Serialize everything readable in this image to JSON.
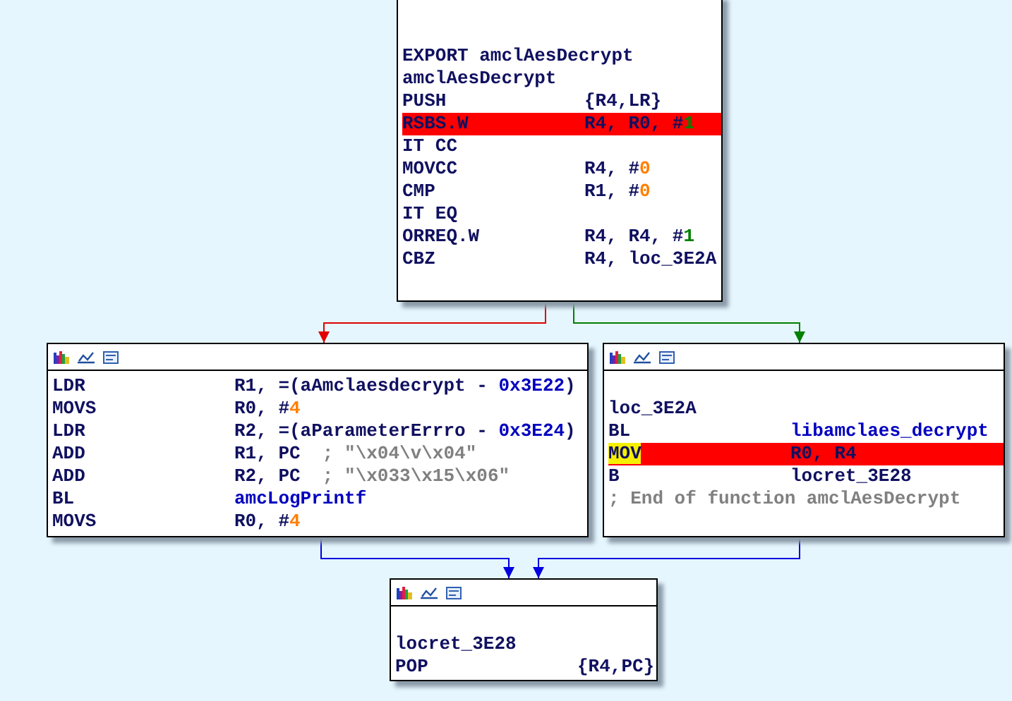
{
  "nodes": [
    {
      "header": false,
      "lines": [
        {
          "kind": "blank"
        },
        {
          "kind": "blank"
        },
        {
          "kind": "label",
          "text": "EXPORT amclAesDecrypt"
        },
        {
          "kind": "label",
          "text": "amclAesDecrypt"
        },
        {
          "kind": "insn",
          "mnemonic": "PUSH",
          "highlighted": false,
          "marked": false,
          "operands": [
            {
              "text": "{R4,LR}",
              "kind": "plain"
            }
          ]
        },
        {
          "kind": "insn",
          "mnemonic": "RSBS.W",
          "highlighted": true,
          "marked": false,
          "operands": [
            {
              "text": "R4, R0, #",
              "kind": "plain"
            },
            {
              "text": "1",
              "kind": "bitmask"
            }
          ]
        },
        {
          "kind": "insn",
          "mnemonic": "IT CC",
          "highlighted": false,
          "marked": false
        },
        {
          "kind": "insn",
          "mnemonic": "MOVCC",
          "highlighted": false,
          "marked": false,
          "operands": [
            {
              "text": "R4, #",
              "kind": "plain"
            },
            {
              "text": "0",
              "kind": "number"
            }
          ]
        },
        {
          "kind": "insn",
          "mnemonic": "CMP",
          "highlighted": false,
          "marked": false,
          "operands": [
            {
              "text": "R1, #",
              "kind": "plain"
            },
            {
              "text": "0",
              "kind": "number"
            }
          ]
        },
        {
          "kind": "insn",
          "mnemonic": "IT EQ",
          "highlighted": false,
          "marked": false
        },
        {
          "kind": "insn",
          "mnemonic": "ORREQ.W",
          "highlighted": false,
          "marked": false,
          "operands": [
            {
              "text": "R4, R4, #",
              "kind": "plain"
            },
            {
              "text": "1",
              "kind": "bitmask"
            }
          ]
        },
        {
          "kind": "insn",
          "mnemonic": "CBZ",
          "highlighted": false,
          "marked": false,
          "operands": [
            {
              "text": "R4, loc_3E2A",
              "kind": "plain"
            }
          ]
        }
      ]
    },
    {
      "header": true,
      "lines": [
        {
          "kind": "insn",
          "mnemonic": "LDR",
          "highlighted": false,
          "marked": false,
          "operands": [
            {
              "text": "R1, =(aAmclaesdecrypt - ",
              "kind": "plain"
            },
            {
              "text": "0x3E22",
              "kind": "name"
            },
            {
              "text": ")",
              "kind": "plain"
            }
          ]
        },
        {
          "kind": "insn",
          "mnemonic": "MOVS",
          "highlighted": false,
          "marked": false,
          "operands": [
            {
              "text": "R0, #",
              "kind": "plain"
            },
            {
              "text": "4",
              "kind": "number"
            }
          ]
        },
        {
          "kind": "insn",
          "mnemonic": "LDR",
          "highlighted": false,
          "marked": false,
          "operands": [
            {
              "text": "R2, =(aParameterErrro - ",
              "kind": "plain"
            },
            {
              "text": "0x3E24",
              "kind": "name"
            },
            {
              "text": ")",
              "kind": "plain"
            }
          ]
        },
        {
          "kind": "insn",
          "mnemonic": "ADD",
          "highlighted": false,
          "marked": false,
          "operands": [
            {
              "text": "R1, PC  ",
              "kind": "plain"
            },
            {
              "text": "; \"\\x04\\v\\x04\"",
              "kind": "comment"
            }
          ]
        },
        {
          "kind": "insn",
          "mnemonic": "ADD",
          "highlighted": false,
          "marked": false,
          "operands": [
            {
              "text": "R2, PC  ",
              "kind": "plain"
            },
            {
              "text": "; \"\\x033\\x15\\x06\"",
              "kind": "comment"
            }
          ]
        },
        {
          "kind": "insn",
          "mnemonic": "BL",
          "highlighted": false,
          "marked": false,
          "operands": [
            {
              "text": "amcLogPrintf",
              "kind": "name"
            }
          ]
        },
        {
          "kind": "insn",
          "mnemonic": "MOVS",
          "highlighted": false,
          "marked": false,
          "operands": [
            {
              "text": "R0, #",
              "kind": "plain"
            },
            {
              "text": "4",
              "kind": "number"
            }
          ]
        }
      ]
    },
    {
      "header": true,
      "lines": [
        {
          "kind": "blank"
        },
        {
          "kind": "label",
          "text": "loc_3E2A"
        },
        {
          "kind": "insn",
          "mnemonic": "BL",
          "highlighted": false,
          "marked": false,
          "operands": [
            {
              "text": "libamclaes_decrypt",
              "kind": "name"
            }
          ]
        },
        {
          "kind": "insn",
          "mnemonic": "MOV",
          "highlighted": true,
          "marked": true,
          "operands": [
            {
              "text": "R0, R4",
              "kind": "plain"
            }
          ]
        },
        {
          "kind": "insn",
          "mnemonic": "B",
          "highlighted": false,
          "marked": false,
          "operands": [
            {
              "text": "locret_3E28",
              "kind": "plain"
            }
          ]
        },
        {
          "kind": "comment",
          "text": "; End of function amclAesDecrypt"
        }
      ]
    },
    {
      "header": true,
      "lines": [
        {
          "kind": "blank"
        },
        {
          "kind": "label",
          "text": "locret_3E28"
        },
        {
          "kind": "insn",
          "mnemonic": "POP",
          "highlighted": false,
          "marked": false,
          "operands": [
            {
              "text": "{R4,PC}",
              "kind": "plain"
            }
          ]
        }
      ]
    }
  ],
  "edges": [
    {
      "color": "#e00000"
    },
    {
      "color": "#008000"
    },
    {
      "color": "#0000e0"
    },
    {
      "color": "#0000e0"
    }
  ]
}
